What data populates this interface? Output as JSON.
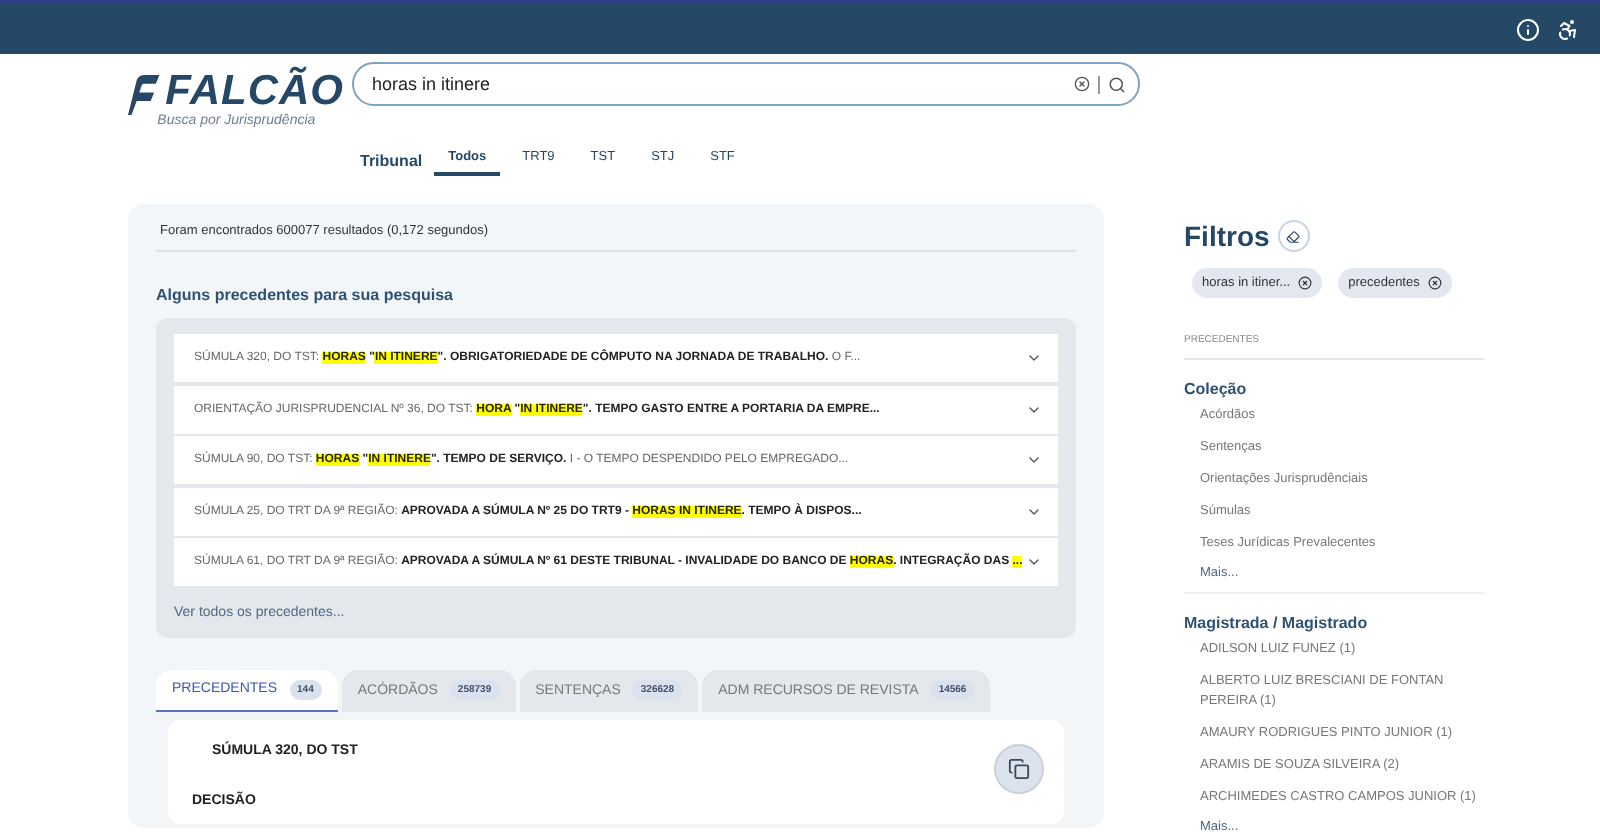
{
  "logo": {
    "name": "FALCÃO",
    "tagline": "Busca por Jurisprudência"
  },
  "search": {
    "value": "horas in itinere"
  },
  "tribunal": {
    "label": "Tribunal",
    "tabs": [
      {
        "label": "Todos",
        "selected": true
      },
      {
        "label": "TRT9",
        "selected": false
      },
      {
        "label": "TST",
        "selected": false
      },
      {
        "label": "STJ",
        "selected": false
      },
      {
        "label": "STF",
        "selected": false
      }
    ]
  },
  "results_summary": "Foram encontrados 600077 resultados (0,172 segundos)",
  "precedents": {
    "title": "Alguns precedentes para sua pesquisa",
    "rows": [
      {
        "segments": [
          {
            "text": "SÚMULA 320, DO TST: ",
            "kind": "plain"
          },
          {
            "text": "HORAS",
            "kind": "highlight"
          },
          {
            "text": " \"",
            "kind": "bold"
          },
          {
            "text": "IN ITINERE",
            "kind": "highlight"
          },
          {
            "text": "\". OBRIGATORIEDADE DE CÔMPUTO NA JORNADA DE TRABALHO.",
            "kind": "bold"
          },
          {
            "text": " O F...",
            "kind": "plain"
          }
        ]
      },
      {
        "segments": [
          {
            "text": "ORIENTAÇÃO JURISPRUDENCIAL Nº 36, DO TST: ",
            "kind": "plain"
          },
          {
            "text": "HORA",
            "kind": "highlight"
          },
          {
            "text": " \"",
            "kind": "bold"
          },
          {
            "text": "IN ITINERE",
            "kind": "highlight"
          },
          {
            "text": "\". TEMPO GASTO ENTRE A PORTARIA DA EMPRE...",
            "kind": "bold"
          }
        ]
      },
      {
        "segments": [
          {
            "text": "SÚMULA 90, DO TST: ",
            "kind": "plain"
          },
          {
            "text": "HORAS",
            "kind": "highlight"
          },
          {
            "text": " \"",
            "kind": "bold"
          },
          {
            "text": "IN ITINERE",
            "kind": "highlight"
          },
          {
            "text": "\". TEMPO DE SERVIÇO.",
            "kind": "bold"
          },
          {
            "text": " I - O TEMPO DESPENDIDO PELO EMPREGADO...",
            "kind": "plain"
          }
        ]
      },
      {
        "segments": [
          {
            "text": "SÚMULA 25, DO TRT DA 9ª REGIÃO: ",
            "kind": "plain"
          },
          {
            "text": "APROVADA A SÚMULA Nº 25 DO TRT9 - ",
            "kind": "bold"
          },
          {
            "text": "HORAS IN ITINERE",
            "kind": "highlight"
          },
          {
            "text": ". TEMPO À DISPOS...",
            "kind": "bold"
          }
        ]
      },
      {
        "segments": [
          {
            "text": "SÚMULA 61, DO TRT DA 9ª REGIÃO: ",
            "kind": "plain"
          },
          {
            "text": "APROVADA A SÚMULA Nº 61 DESTE TRIBUNAL - INVALIDADE DO BANCO DE ",
            "kind": "bold"
          },
          {
            "text": "HORAS",
            "kind": "highlight"
          },
          {
            "text": ". INTEGRAÇÃO DAS ",
            "kind": "bold"
          },
          {
            "text": "...",
            "kind": "highlight"
          }
        ]
      }
    ],
    "see_all": "Ver todos os precedentes..."
  },
  "result_tabs": [
    {
      "label": "PRECEDENTES",
      "count": "144",
      "selected": true
    },
    {
      "label": "ACÓRDÃOS",
      "count": "258739",
      "selected": false
    },
    {
      "label": "SENTENÇAS",
      "count": "326628",
      "selected": false
    },
    {
      "label": "ADM RECURSOS DE REVISTA",
      "count": "14566",
      "selected": false
    }
  ],
  "result_card": {
    "title": "SÚMULA 320, DO TST",
    "section": "DECISÃO"
  },
  "filters": {
    "title": "Filtros",
    "chips": [
      "horas in itiner...",
      "precedentes"
    ],
    "group_label": "PRECEDENTES",
    "sections": [
      {
        "title": "Coleção",
        "items": [
          "Acórdãos",
          "Sentenças",
          "Orientações Jurisprudênciais",
          "Súmulas",
          "Teses Jurídicas Prevalecentes"
        ],
        "more": "Mais..."
      },
      {
        "title": "Magistrada / Magistrado",
        "items": [
          "ADILSON LUIZ FUNEZ   (1)",
          "ALBERTO LUIZ BRESCIANI DE FONTAN PEREIRA   (1)",
          "AMAURY RODRIGUES PINTO JUNIOR   (1)",
          "ARAMIS DE SOUZA SILVEIRA   (2)",
          "ARCHIMEDES CASTRO CAMPOS JUNIOR (1)"
        ],
        "more": "Mais..."
      }
    ]
  }
}
